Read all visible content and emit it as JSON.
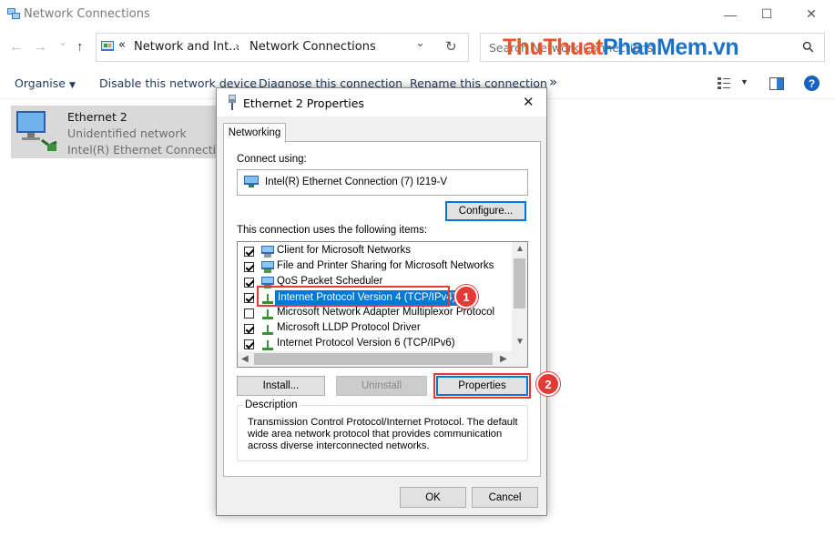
{
  "window": {
    "title": "Network Connections",
    "minimize_glyph": "—",
    "maximize_glyph": "☐",
    "close_glyph": "✕"
  },
  "nav": {
    "back_glyph": "←",
    "forward_glyph": "→",
    "recent_glyph": "⌄",
    "up_glyph": "↑",
    "address_chevron": "«",
    "breadcrumb_1": "Network and Int...",
    "separator": "›",
    "breadcrumb_2": "Network Connections",
    "dropdown_glyph": "⌄",
    "refresh_glyph": "↻",
    "search_placeholder": "Search Network Connections",
    "search_glyph": "⚲"
  },
  "watermark": {
    "part1": "Thu",
    "part2": "Thuat",
    "part3": "PhanMem",
    "part4": ".vn"
  },
  "toolbar": {
    "organise": "Organise",
    "disable": "Disable this network device",
    "diagnose": "Diagnose this connection",
    "rename": "Rename this connection",
    "more": "»",
    "help_glyph": "?"
  },
  "connection": {
    "name": "Ethernet 2",
    "status": "Unidentified network",
    "adapter": "Intel(R) Ethernet Connection"
  },
  "dialog": {
    "title": "Ethernet 2 Properties",
    "close_glyph": "✕",
    "tab": "Networking",
    "connect_using_label": "Connect using:",
    "adapter_name": "Intel(R) Ethernet Connection (7) I219-V",
    "configure_button": "Configure...",
    "items_label": "This connection uses the following items:",
    "items": [
      {
        "label": "Client for Microsoft Networks",
        "checked": true,
        "icon": "network-client-icon"
      },
      {
        "label": "File and Printer Sharing for Microsoft Networks",
        "checked": true,
        "icon": "network-service-icon"
      },
      {
        "label": "QoS Packet Scheduler",
        "checked": true,
        "icon": "network-service-icon"
      },
      {
        "label": "Internet Protocol Version 4 (TCP/IPv4)",
        "checked": true,
        "icon": "protocol-icon",
        "selected": true
      },
      {
        "label": "Microsoft Network Adapter Multiplexor Protocol",
        "checked": false,
        "icon": "protocol-icon"
      },
      {
        "label": "Microsoft LLDP Protocol Driver",
        "checked": true,
        "icon": "protocol-icon"
      },
      {
        "label": "Internet Protocol Version 6 (TCP/IPv6)",
        "checked": true,
        "icon": "protocol-icon"
      }
    ],
    "install_button": "Install...",
    "uninstall_button": "Uninstall",
    "properties_button": "Properties",
    "description_legend": "Description",
    "description_text": "Transmission Control Protocol/Internet Protocol. The default wide area network protocol that provides communication across diverse interconnected networks.",
    "ok_button": "OK",
    "cancel_button": "Cancel"
  },
  "annotations": {
    "step1": "1",
    "step2": "2",
    "color": "#e53935"
  },
  "colors": {
    "selection": "#0078d7",
    "watermark_orange": "#e8542b",
    "watermark_blue": "#1a73c8"
  }
}
